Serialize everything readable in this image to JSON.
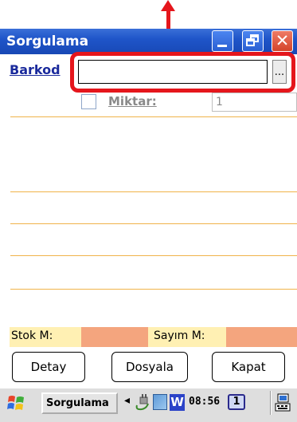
{
  "window": {
    "title": "Sorgulama"
  },
  "form": {
    "barcode_label": "Barkod",
    "barcode_value": "",
    "browse_label": "...",
    "miktar_label": "Miktar:",
    "miktar_value": "1"
  },
  "summary": {
    "stok_label": "Stok M:",
    "sayim_label": "Sayım M:"
  },
  "buttons": {
    "detay": "Detay",
    "dosyala": "Dosyala",
    "kapat": "Kapat"
  },
  "taskbar": {
    "task_label": "Sorgulama",
    "clock": "08:56",
    "desktop_number": "1",
    "w_app": "W"
  },
  "colors": {
    "highlight": "#e5161c",
    "titlebar": "#1f55c9",
    "line": "#f0b34a",
    "value_field": "#f4a57e"
  }
}
